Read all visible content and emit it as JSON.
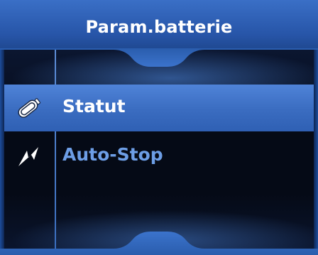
{
  "header": {
    "title": "Param.batterie"
  },
  "menu": {
    "items": [
      {
        "label": "Statut",
        "icon": "battery-icon",
        "selected": true
      },
      {
        "label": "Auto-Stop",
        "icon": "lightning-icon",
        "selected": false
      }
    ]
  },
  "colors": {
    "header_blue": "#2c5eb0",
    "selected_row": "#3f71c6",
    "inactive_label": "#6d9ee6",
    "background": "#050a16"
  }
}
